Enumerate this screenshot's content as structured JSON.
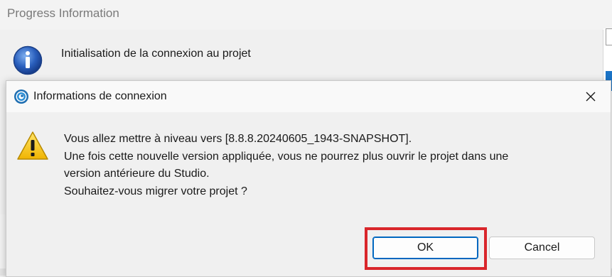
{
  "background_window": {
    "title": "Progress Information",
    "message": "Initialisation de la connexion au projet",
    "icon": "info-icon"
  },
  "dialog": {
    "title": "Informations de connexion",
    "app_icon": "app-swirl-icon",
    "close_icon": "close-icon",
    "warning_icon": "warning-icon",
    "message_lines": [
      "Vous allez mettre à niveau vers [8.8.8.20240605_1943-SNAPSHOT].",
      "Une fois cette nouvelle version appliquée, vous ne pourrez plus ouvrir le projet dans une",
      "version antérieure du Studio.",
      "Souhaitez-vous migrer votre projet ?"
    ],
    "buttons": {
      "ok": "OK",
      "cancel": "Cancel"
    }
  },
  "colors": {
    "highlight": "#d9262b",
    "accent": "#0067c0",
    "info_blue": "#2a5fbd",
    "warning_yellow": "#f5c400"
  }
}
